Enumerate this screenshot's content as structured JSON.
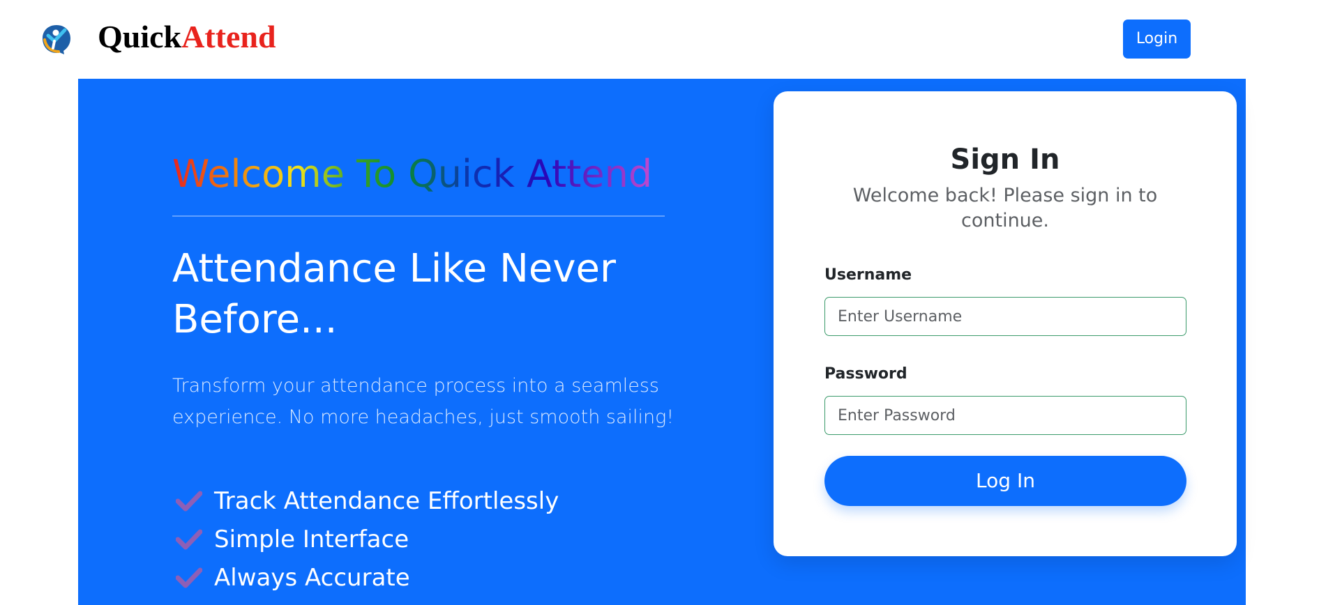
{
  "brand": {
    "name_part1": "Quick",
    "name_part2": "Attend",
    "logo_icon": "person-check-icon",
    "name_colors": {
      "part1": "#000000",
      "part2": "#e8231d"
    }
  },
  "navbar": {
    "login_label": "Login"
  },
  "hero": {
    "welcome_title": "Welcome To Quick Attend",
    "heading": "Attendance Like Never Before...",
    "description": "Transform your attendance process into a seamless experience. No more headaches, just smooth sailing!",
    "features": [
      {
        "label": "Track Attendance Effortlessly",
        "icon": "check-icon"
      },
      {
        "label": "Simple Interface",
        "icon": "check-icon"
      },
      {
        "label": "Always Accurate",
        "icon": "check-icon"
      }
    ]
  },
  "signin": {
    "title": "Sign In",
    "subtitle": "Welcome back! Please sign in to continue.",
    "username_label": "Username",
    "username_placeholder": "Enter Username",
    "username_value": "",
    "password_label": "Password",
    "password_placeholder": "Enter Password",
    "password_value": "",
    "submit_label": "Log In"
  },
  "colors": {
    "accent": "#0d6efd",
    "check_color": "#8e5fb6",
    "input_border": "#3a9a6a"
  }
}
